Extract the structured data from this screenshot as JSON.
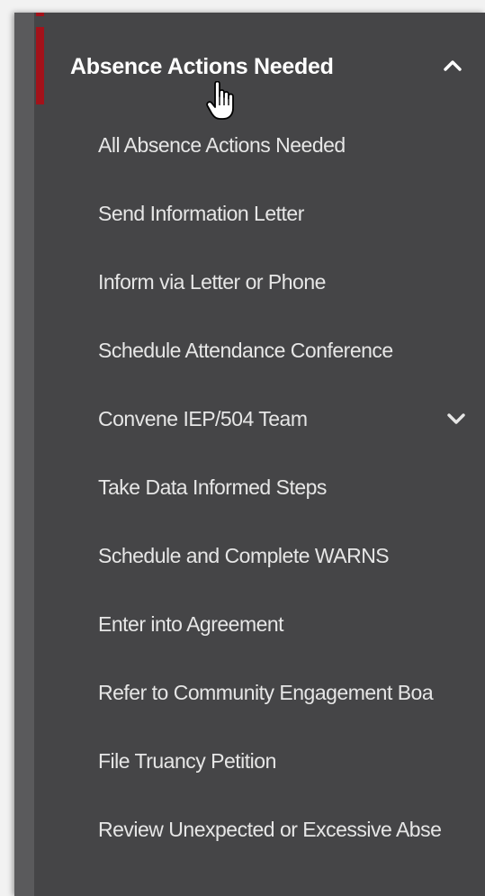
{
  "section": {
    "title": "Absence Actions Needed",
    "expanded": true,
    "toggle_icon": "chevron-up-icon"
  },
  "items": [
    {
      "label": "All Absence Actions Needed"
    },
    {
      "label": "Send Information Letter"
    },
    {
      "label": "Inform via Letter or Phone"
    },
    {
      "label": "Schedule Attendance Conference"
    },
    {
      "label": "Convene IEP/504 Team",
      "has_submenu": true,
      "toggle_icon": "chevron-down-icon"
    },
    {
      "label": "Take Data Informed Steps"
    },
    {
      "label": "Schedule and Complete WARNS"
    },
    {
      "label": "Enter into Agreement"
    },
    {
      "label": "Refer to Community Engagement Boa"
    },
    {
      "label": "File Truancy Petition"
    },
    {
      "label": "Review Unexpected or Excessive Abse"
    }
  ],
  "colors": {
    "panel_bg": "#454547",
    "accent": "#a3121a",
    "header_text": "#ffffff",
    "item_text": "#e6e6e6"
  },
  "cursor_icon": "hand-pointer-icon"
}
